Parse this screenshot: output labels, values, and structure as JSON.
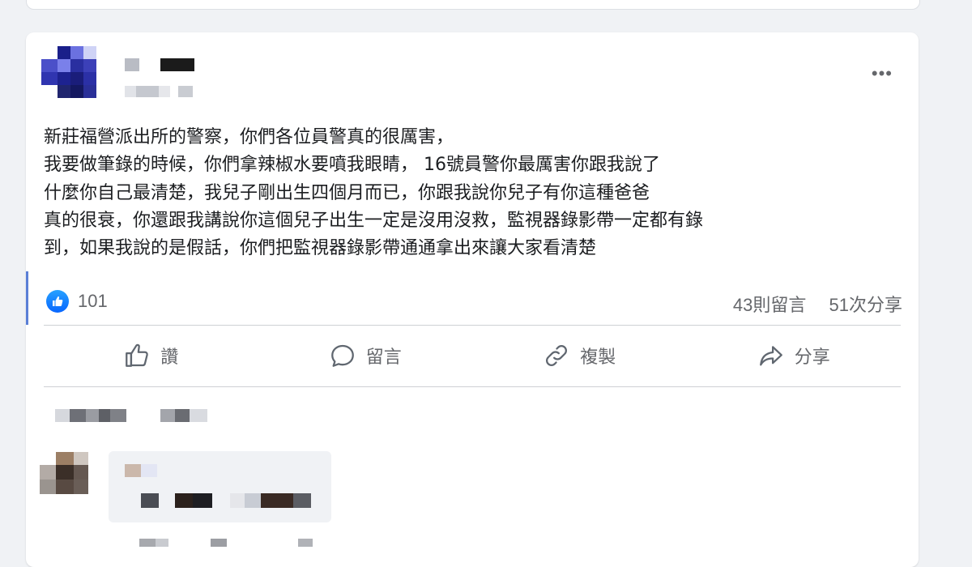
{
  "post": {
    "text_lines": [
      "新莊福營派出所的警察，你們各位員警真的很厲害，",
      "￼我要做筆錄的時候，你們拿辣椒水要噴我眼睛，￼ 16號員警你最厲害你跟我說了",
      "什麼你自己最清楚，￼我兒子剛出生四個月而已，￼你跟我說￼你兒子有你這種爸爸",
      "真的很衰，你還跟我講說你這個兒子出生一定是沒用沒救，監視器錄影帶一定都有錄",
      "到，￼如果我說的是假話，你們把監視器錄影帶通通拿出來讓大家看清楚"
    ],
    "more_icon": "•••",
    "like_count": "101",
    "comments_count": "43則留言",
    "shares_count": "51次分享"
  },
  "actions": {
    "like": "讚",
    "comment": "留言",
    "copy": "複製",
    "share": "分享"
  },
  "colors": {
    "accent": "#0866ff",
    "secondary_text": "#65676b",
    "background": "#f0f2f5"
  },
  "icons": [
    "thumbs-up-icon",
    "comment-icon",
    "link-icon",
    "share-icon",
    "more-icon"
  ]
}
